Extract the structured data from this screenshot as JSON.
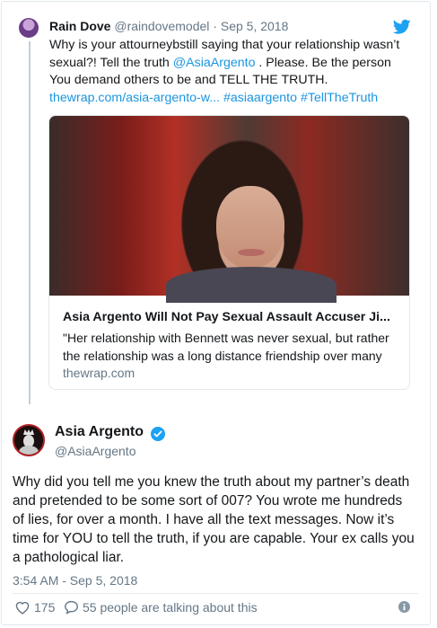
{
  "quoted_tweet": {
    "name": "Rain Dove",
    "handle": "@raindovemodel",
    "separator": "·",
    "date": "Sep 5, 2018",
    "text_line1": "Why is your attourneybstill saying that your relationship wasn’t",
    "text_line2_before": "sexual?! Tell the truth ",
    "mention": "@AsiaArgento",
    "text_line2_after": " . Please. Be the person",
    "text_line3": "You demand others to be and TELL THE TRUTH.",
    "links_line": "thewrap.com/asia-argento-w... #asiaargento #TellTheTruth",
    "card": {
      "title": "Asia Argento Will Not Pay Sexual Assault Accuser Ji...",
      "description": "\"Her relationship with Bennett was never sexual, but rather the relationship was a long distance friendship over many",
      "domain": "thewrap.com"
    }
  },
  "main_tweet": {
    "name": "Asia Argento",
    "handle": "@AsiaArgento",
    "text": "Why did you tell me you knew the truth about my partner’s death and pretended to be some sort of 007? You wrote me hundreds of lies, for over a month. I have all the text messages. Now it’s time for YOU to tell the truth, if you are capable. Your ex calls you a pathological liar.",
    "timestamp": "3:54 AM - Sep 5, 2018",
    "likes": "175",
    "talking": "55 people are talking about this"
  },
  "icons": [
    "twitter-bird-icon",
    "verified-icon",
    "heart-icon",
    "reply-icon",
    "info-icon"
  ],
  "colors": {
    "link": "#1b95e0",
    "muted": "#657786",
    "verified": "#1da1f2"
  }
}
